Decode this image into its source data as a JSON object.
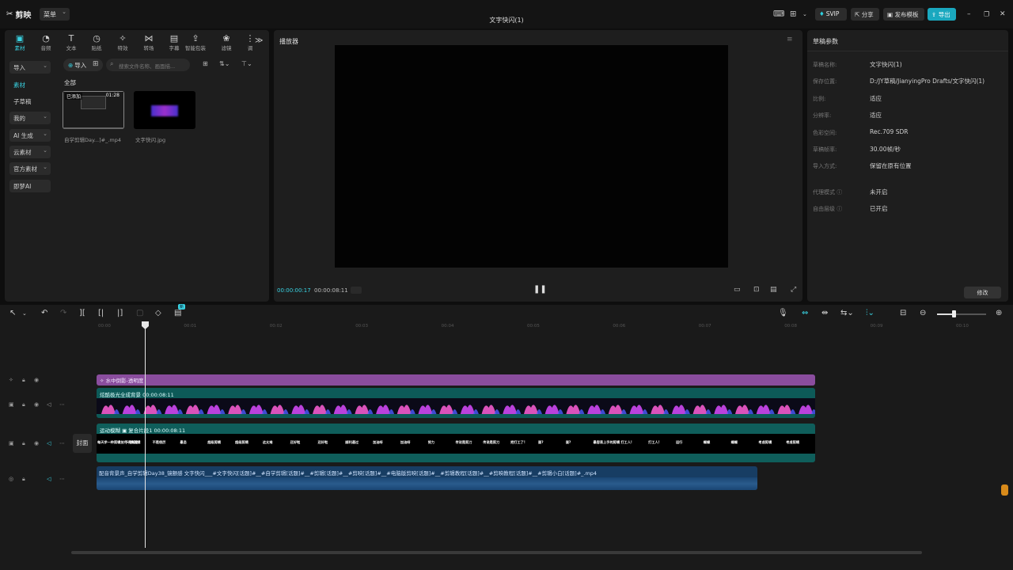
{
  "titlebar": {
    "app_name": "剪映",
    "menu_label": "菜单",
    "project_title": "文字快闪(1)",
    "svip_label": "SVIP",
    "share_label": "分享",
    "publish_template_label": "发布模板",
    "export_label": "导出"
  },
  "toolbox": [
    {
      "label": "素材",
      "icon": "media-icon",
      "glyph": "▣"
    },
    {
      "label": "音频",
      "icon": "audio-icon",
      "glyph": "◔"
    },
    {
      "label": "文本",
      "icon": "text-icon",
      "glyph": "T"
    },
    {
      "label": "贴纸",
      "icon": "sticker-icon",
      "glyph": "◷"
    },
    {
      "label": "特效",
      "icon": "effects-icon",
      "glyph": "✧"
    },
    {
      "label": "转场",
      "icon": "transition-icon",
      "glyph": "⋈"
    },
    {
      "label": "字幕",
      "icon": "caption-icon",
      "glyph": "▤"
    },
    {
      "label": "智能包装",
      "icon": "smart-pack-icon",
      "glyph": "⇪"
    },
    {
      "label": "滤镜",
      "icon": "filter-icon",
      "glyph": "❀"
    },
    {
      "label": "调",
      "icon": "adjust-icon",
      "glyph": "⋮"
    }
  ],
  "sidebar": {
    "items": [
      {
        "label": "导入",
        "chevron": "⌄"
      },
      {
        "label": "素材",
        "chevron": ""
      },
      {
        "label": "子草稿",
        "chevron": ""
      },
      {
        "label": "我的",
        "chevron": "⌄"
      },
      {
        "label": "AI 生成",
        "chevron": "⌄"
      },
      {
        "label": "云素材",
        "chevron": "⌄"
      },
      {
        "label": "官方素材",
        "chevron": "⌄"
      },
      {
        "label": "即梦AI",
        "chevron": ""
      }
    ]
  },
  "media": {
    "import_label": "导入",
    "search_placeholder": "搜索文件名称、画面描...",
    "all_label": "全部",
    "items": [
      {
        "name": "自学剪辑Day...]#_.mp4",
        "duration": "01:28",
        "added_label": "已添加"
      },
      {
        "name": "文字快闪.jpg"
      }
    ]
  },
  "player": {
    "title": "播放器",
    "current_time": "00:00:00:17",
    "total_time": "00:00:08:11"
  },
  "draft_params": {
    "title": "草稿参数",
    "rows": [
      {
        "label": "草稿名称:",
        "value": "文字快闪(1)"
      },
      {
        "label": "保存位置:",
        "value": "D:/JY草稿/JianyingPro Drafts/文字快闪(1)"
      },
      {
        "label": "比例:",
        "value": "适应"
      },
      {
        "label": "分辨率:",
        "value": "适应"
      },
      {
        "label": "色彩空间:",
        "value": "Rec.709 SDR"
      },
      {
        "label": "草稿帧率:",
        "value": "30.00帧/秒"
      },
      {
        "label": "导入方式:",
        "value": "保留在原有位置"
      },
      {
        "label": "代理模式 ⓘ",
        "value": "未开启"
      },
      {
        "label": "自由层级 ⓘ",
        "value": "已开启"
      }
    ],
    "modify_label": "修改"
  },
  "timeline": {
    "ruler": [
      "00:00",
      "00:01",
      "00:02",
      "00:03",
      "00:04",
      "00:05",
      "00:06",
      "00:07",
      "00:08",
      "00:09",
      "00:10"
    ],
    "new_badge": "新",
    "cover_label": "封面",
    "effect_clip": "水中倒影-透明度",
    "video_clip": "炫酷极光全成背景  00:00:08:11",
    "text_clip": "运动模糊  ▣  复合片段1  00:00:08:11",
    "text_words": [
      "每天学一种剪辑技巧一种剪辑",
      "不是叛逆",
      "不是很厉",
      "最忌",
      "超级剪辑",
      "超级剪辑",
      "这太难",
      "还好啦",
      "还好啦",
      "顺利通过",
      "加油呀",
      "加油呀",
      "努力",
      "传说是剪刀",
      "传说是剪刀",
      "把打工了!",
      "蛋?",
      "蛋?",
      "最容易上手的剪辑",
      "打工人!",
      "打工人!",
      "运行",
      "蝶蝶",
      "蝶蝶",
      "考虑剪辑",
      "考虑剪辑"
    ],
    "audio_clip": "配音背景声_自学剪辑Day38_镜颤感 文字快闪___#文字快闪[话题]#__#自学剪辑[话题]#__#剪辑[话题]#__#剪映[话题]#__#电脑版剪映[话题]#__#剪辑教程[话题]#__#剪映教程[话题]#__#剪辑小白[话题]#_.mp4"
  },
  "colors": {
    "accent": "#39d3e3",
    "effect_clip": "#8a4d9e",
    "video_clip": "#0d5a58",
    "text_clip": "#0f5e5b",
    "audio_clip": "#173d63",
    "export_button": "#1aa8bf"
  }
}
